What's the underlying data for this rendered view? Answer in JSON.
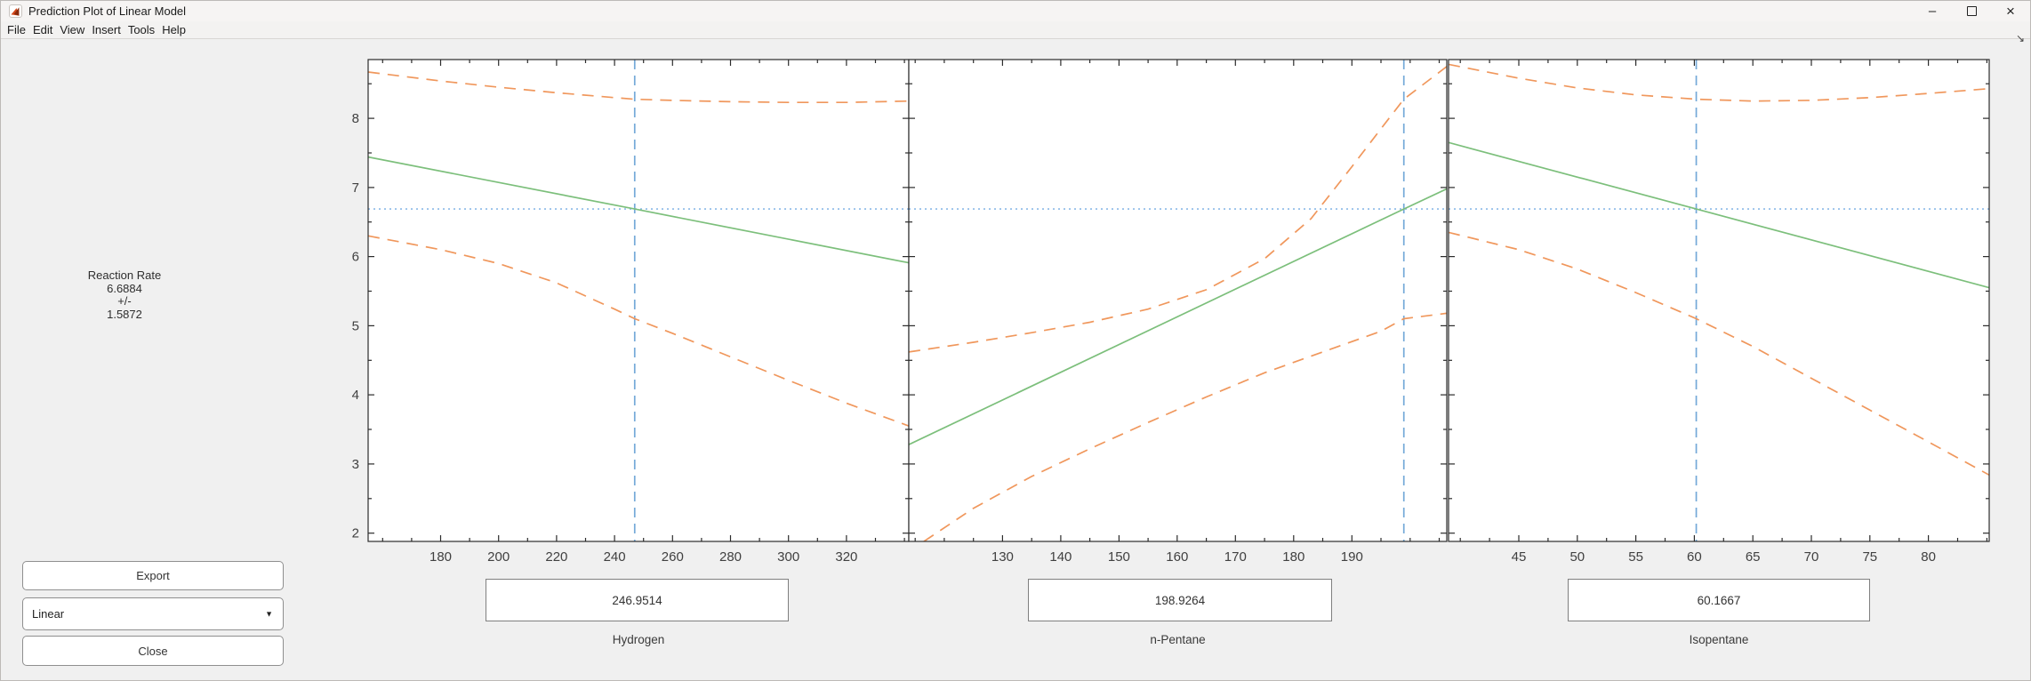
{
  "window": {
    "title": "Prediction Plot of Linear Model",
    "controls": {
      "minimize": "–",
      "close": "×"
    }
  },
  "menu": [
    "File",
    "Edit",
    "View",
    "Insert",
    "Tools",
    "Help"
  ],
  "response_panel": {
    "title": "Reaction Rate",
    "value": "6.6884",
    "plus_minus": "+/-",
    "interval": "1.5872"
  },
  "buttons": {
    "export": "Export",
    "close": "Close"
  },
  "model_dropdown": {
    "value": "Linear"
  },
  "predictors": [
    {
      "name": "Hydrogen",
      "value": "246.9514"
    },
    {
      "name": "n-Pentane",
      "value": "198.9264"
    },
    {
      "name": "Isopentane",
      "value": "60.1667"
    }
  ],
  "colors": {
    "fit_line": "#7cbf7b",
    "bound_line": "#f0975c",
    "ref_vline": "#74a9d8",
    "ref_hline": "#8ab9e8",
    "axis": "#2b2b2b",
    "tick_text": "#404040",
    "plot_bg": "#ffffff"
  },
  "chart_data": [
    {
      "type": "line",
      "xlabel": "Hydrogen",
      "xlim": [
        155,
        341.5
      ],
      "ylim": [
        1.88,
        8.85
      ],
      "xticks": [
        180,
        200,
        220,
        240,
        260,
        280,
        300,
        320
      ],
      "minor_x_step": 10,
      "yticks": [
        2,
        3,
        4,
        5,
        6,
        7,
        8
      ],
      "minor_y_step": 0.5,
      "y_tick_labels_visible": true,
      "reference": {
        "x": 246.9514,
        "y": 6.6884
      },
      "series": [
        {
          "name": "fit",
          "style": "solid",
          "color_key": "fit_line",
          "points": [
            [
              155,
              7.44
            ],
            [
              246.9514,
              6.6884
            ],
            [
              341.5,
              5.91
            ]
          ]
        },
        {
          "name": "upper-confidence-bound",
          "style": "dashed",
          "color_key": "bound_line",
          "points": [
            [
              155,
              8.67
            ],
            [
              180,
              8.54
            ],
            [
              200,
              8.45
            ],
            [
              220,
              8.37
            ],
            [
              240,
              8.3
            ],
            [
              246.95,
              8.276
            ],
            [
              260,
              8.26
            ],
            [
              280,
              8.24
            ],
            [
              300,
              8.23
            ],
            [
              320,
              8.23
            ],
            [
              341.5,
              8.25
            ]
          ]
        },
        {
          "name": "lower-confidence-bound",
          "style": "dashed",
          "color_key": "bound_line",
          "points": [
            [
              155,
              6.3
            ],
            [
              180,
              6.1
            ],
            [
              200,
              5.9
            ],
            [
              220,
              5.62
            ],
            [
              240,
              5.24
            ],
            [
              246.95,
              5.101
            ],
            [
              260,
              4.89
            ],
            [
              280,
              4.55
            ],
            [
              300,
              4.21
            ],
            [
              320,
              3.88
            ],
            [
              341.5,
              3.55
            ]
          ]
        }
      ]
    },
    {
      "type": "line",
      "xlabel": "n-Pentane",
      "xlim": [
        113.9,
        206.3
      ],
      "ylim": [
        1.88,
        8.85
      ],
      "xticks": [
        130,
        140,
        150,
        160,
        170,
        180,
        190
      ],
      "minor_x_step": 5,
      "yticks": [
        2,
        3,
        4,
        5,
        6,
        7,
        8
      ],
      "minor_y_step": 0.5,
      "y_tick_labels_visible": false,
      "reference": {
        "x": 198.9264,
        "y": 6.6884
      },
      "series": [
        {
          "name": "fit",
          "style": "solid",
          "color_key": "fit_line",
          "points": [
            [
              113.9,
              3.28
            ],
            [
              198.9264,
              6.6884
            ],
            [
              206.3,
              6.98
            ]
          ]
        },
        {
          "name": "upper-confidence-bound",
          "style": "dashed",
          "color_key": "bound_line",
          "points": [
            [
              113.9,
              4.62
            ],
            [
              125,
              4.76
            ],
            [
              135,
              4.9
            ],
            [
              145,
              5.05
            ],
            [
              155,
              5.24
            ],
            [
              165,
              5.52
            ],
            [
              175,
              5.97
            ],
            [
              183,
              6.55
            ],
            [
              190,
              7.3
            ],
            [
              195,
              7.85
            ],
            [
              198.93,
              8.276
            ],
            [
              206.3,
              8.75
            ]
          ]
        },
        {
          "name": "lower-confidence-bound",
          "style": "dashed",
          "color_key": "bound_line",
          "points": [
            [
              116.5,
              1.88
            ],
            [
              125,
              2.36
            ],
            [
              135,
              2.82
            ],
            [
              145,
              3.22
            ],
            [
              155,
              3.6
            ],
            [
              165,
              3.97
            ],
            [
              175,
              4.32
            ],
            [
              185,
              4.62
            ],
            [
              195,
              4.92
            ],
            [
              198.93,
              5.101
            ],
            [
              206.3,
              5.18
            ]
          ]
        }
      ]
    },
    {
      "type": "line",
      "xlabel": "Isopentane",
      "xlim": [
        39,
        85.2
      ],
      "ylim": [
        1.88,
        8.85
      ],
      "xticks": [
        45,
        50,
        55,
        60,
        65,
        70,
        75,
        80
      ],
      "minor_x_step": 2.5,
      "yticks": [
        2,
        3,
        4,
        5,
        6,
        7,
        8
      ],
      "minor_y_step": 0.5,
      "y_tick_labels_visible": false,
      "reference": {
        "x": 60.1667,
        "y": 6.6884
      },
      "series": [
        {
          "name": "fit",
          "style": "solid",
          "color_key": "fit_line",
          "points": [
            [
              39,
              7.65
            ],
            [
              60.1667,
              6.6884
            ],
            [
              85.2,
              5.55
            ]
          ]
        },
        {
          "name": "upper-confidence-bound",
          "style": "dashed",
          "color_key": "bound_line",
          "points": [
            [
              39,
              8.78
            ],
            [
              45,
              8.58
            ],
            [
              50,
              8.44
            ],
            [
              55,
              8.34
            ],
            [
              60.17,
              8.276
            ],
            [
              65,
              8.25
            ],
            [
              70,
              8.26
            ],
            [
              75,
              8.3
            ],
            [
              80,
              8.36
            ],
            [
              85.2,
              8.43
            ]
          ]
        },
        {
          "name": "lower-confidence-bound",
          "style": "dashed",
          "color_key": "bound_line",
          "points": [
            [
              39,
              6.35
            ],
            [
              45,
              6.1
            ],
            [
              50,
              5.82
            ],
            [
              55,
              5.48
            ],
            [
              60.17,
              5.101
            ],
            [
              65,
              4.7
            ],
            [
              70,
              4.24
            ],
            [
              75,
              3.78
            ],
            [
              80,
              3.32
            ],
            [
              85.2,
              2.84
            ]
          ]
        }
      ]
    }
  ]
}
